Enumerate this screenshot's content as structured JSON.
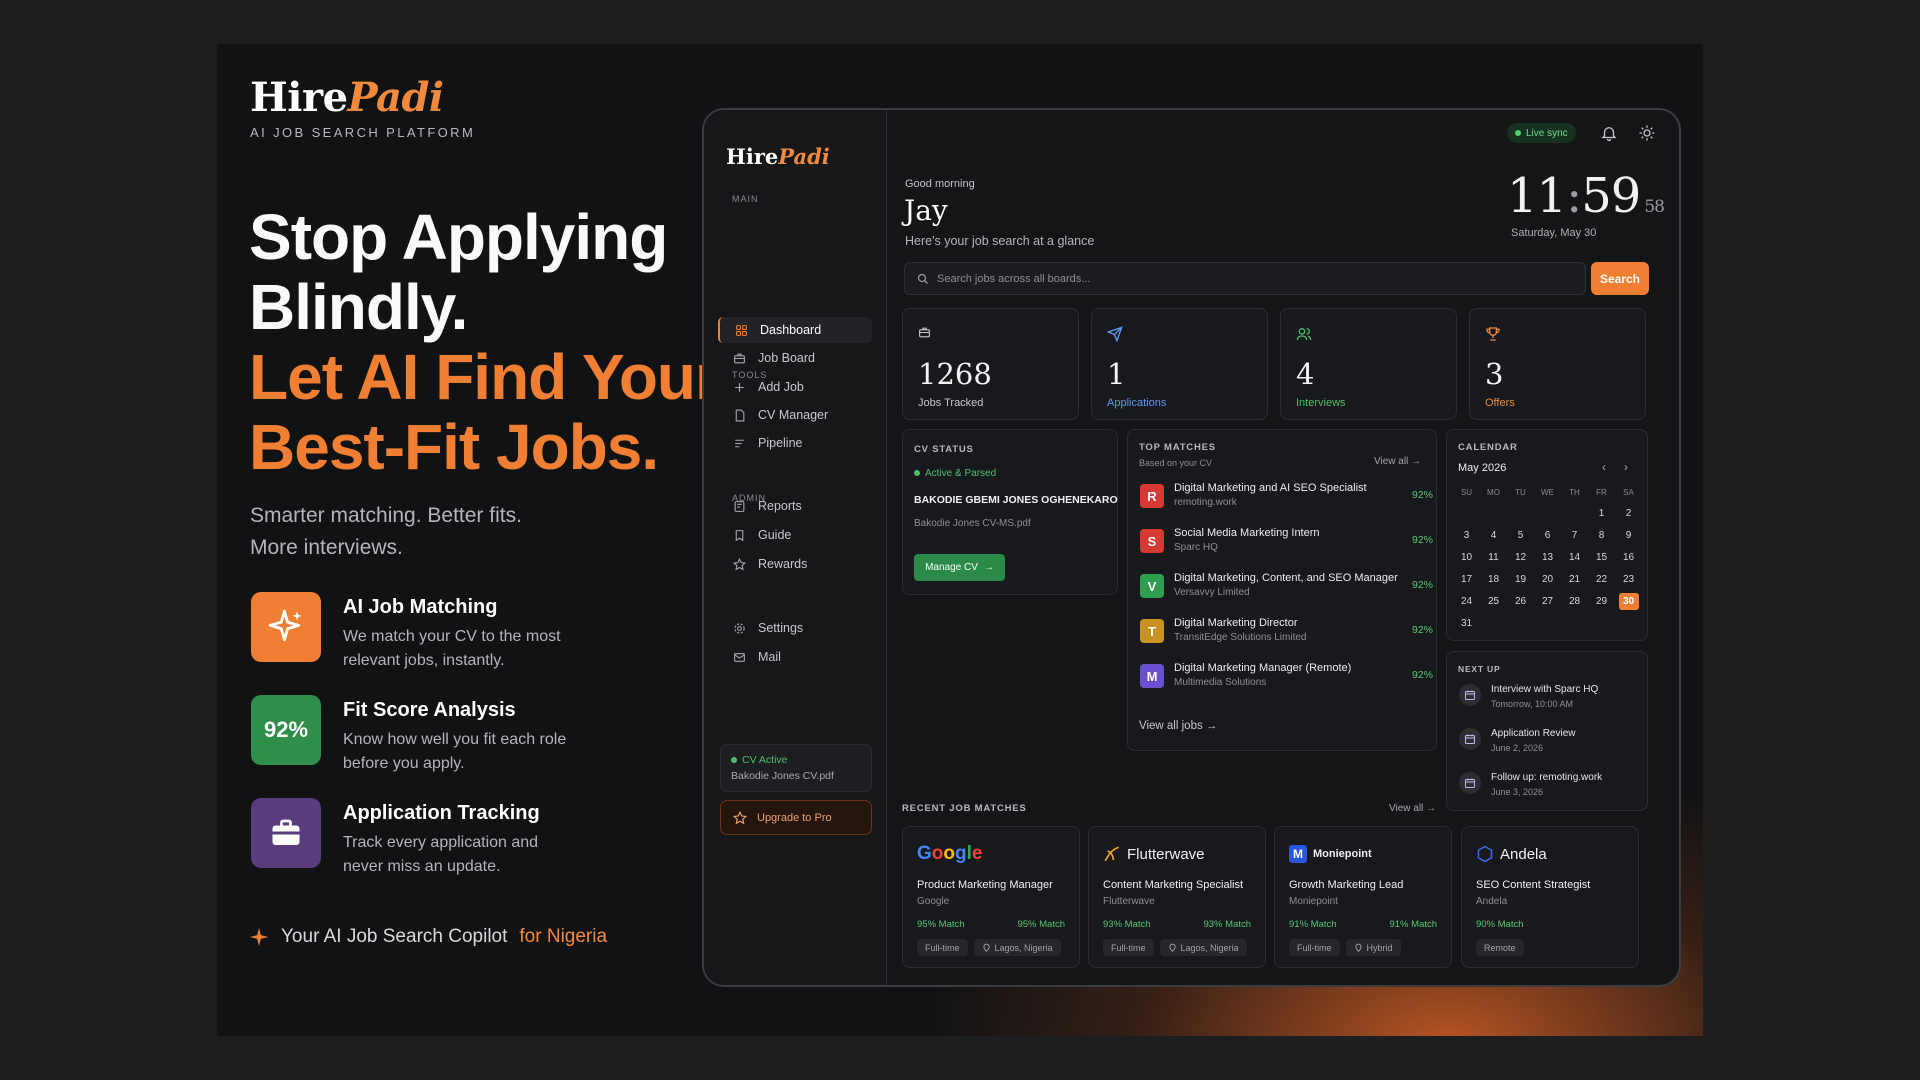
{
  "brand": {
    "name_part1": "Hire",
    "name_part2": "Padi",
    "tagline": "AI JOB SEARCH PLATFORM"
  },
  "hero": {
    "line1": "Stop Applying",
    "line2": "Blindly.",
    "line3": "Let AI Find Your",
    "line4": "Best-Fit Jobs."
  },
  "subhead": {
    "line1": "Smarter matching. Better fits.",
    "line2": "More interviews."
  },
  "features": [
    {
      "icon": "sparkle-icon",
      "badge": "",
      "title": "AI Job Matching",
      "desc_line1": "We match your CV to the most",
      "desc_line2": "relevant jobs, instantly.",
      "color": "#f07f33"
    },
    {
      "icon": "",
      "badge": "92%",
      "title": "Fit Score Analysis",
      "desc_line1": "Know how well you fit each role",
      "desc_line2": "before you apply.",
      "color": "#2f8f4a"
    },
    {
      "icon": "briefcase-icon",
      "badge": "",
      "title": "Application Tracking",
      "desc_line1": "Track every application and",
      "desc_line2": "never miss an update.",
      "color": "#5a3d7e"
    }
  ],
  "copilot": {
    "text": "Your AI Job Search Copilot",
    "accent": "for Nigeria"
  },
  "app": {
    "logo_part1": "Hire",
    "logo_part2": "Padi",
    "sections": {
      "main": "MAIN",
      "tools": "TOOLS",
      "admin": "ADMIN"
    },
    "nav": [
      {
        "label": "Dashboard",
        "icon": "grid-icon",
        "active": true
      },
      {
        "label": "Job Board",
        "icon": "briefcase-icon"
      },
      {
        "label": "Add Job",
        "icon": "plus-icon"
      },
      {
        "label": "CV Manager",
        "icon": "document-icon"
      },
      {
        "label": "Pipeline",
        "icon": "sliders-icon"
      },
      {
        "label": "Reports",
        "icon": "report-icon"
      },
      {
        "label": "Guide",
        "icon": "bookmark-icon"
      },
      {
        "label": "Rewards",
        "icon": "star-icon"
      },
      {
        "label": "Settings",
        "icon": "gear-icon"
      },
      {
        "label": "Mail",
        "icon": "mail-icon"
      }
    ],
    "cv_active": {
      "status": "CV Active",
      "file": "Bakodie Jones CV.pdf"
    },
    "upgrade": "Upgrade to Pro",
    "live_sync": "Live sync",
    "greeting": "Good morning",
    "user": "Jay",
    "glance": "Here's your job search at a glance",
    "clock": {
      "hours": "11",
      "minutes": "59",
      "seconds": "58",
      "date": "Saturday, May 30"
    },
    "search": {
      "placeholder": "Search jobs across all boards...",
      "button": "Search"
    },
    "stats": [
      {
        "value": "1268",
        "label": "Jobs Tracked",
        "color": "#c8c8cc",
        "icon": "briefcase-icon"
      },
      {
        "value": "1",
        "label": "Applications",
        "color": "#5b9cf0",
        "icon": "send-icon"
      },
      {
        "value": "4",
        "label": "Interviews",
        "color": "#48c06a",
        "icon": "users-icon"
      },
      {
        "value": "3",
        "label": "Offers",
        "color": "#f08a3c",
        "icon": "trophy-icon"
      }
    ],
    "cv_status": {
      "title": "CV STATUS",
      "state": "Active & Parsed",
      "owner": "BAKODIE GBEMI JONES OGHENEKARO",
      "file": "Bakodie Jones CV-MS.pdf",
      "button": "Manage CV"
    },
    "top_matches": {
      "title": "TOP MATCHES",
      "subtitle": "Based on your CV",
      "view_all": "View all",
      "footer": "View all jobs",
      "items": [
        {
          "letter": "R",
          "title": "Digital Marketing and AI SEO Specialist",
          "company": "remoting.work",
          "score": "92%",
          "color": "#d63a32"
        },
        {
          "letter": "S",
          "title": "Social Media Marketing Intern",
          "company": "Sparc HQ",
          "score": "92%",
          "color": "#d63a32"
        },
        {
          "letter": "V",
          "title": "Digital Marketing, Content, and SEO Manager",
          "company": "Versavvy Limited",
          "score": "92%",
          "color": "#2e9e4f"
        },
        {
          "letter": "T",
          "title": "Digital Marketing Director",
          "company": "TransitEdge Solutions Limited",
          "score": "92%",
          "color": "#c99324"
        },
        {
          "letter": "M",
          "title": "Digital Marketing Manager (Remote)",
          "company": "Multimedia Solutions",
          "score": "92%",
          "color": "#6b4fd1"
        }
      ]
    },
    "calendar": {
      "title": "CALENDAR",
      "month": "May 2026",
      "weekdays": [
        "SU",
        "MO",
        "TU",
        "WE",
        "TH",
        "FR",
        "SA"
      ],
      "first_weekday": 5,
      "days": 31,
      "today": 30
    },
    "next_up": {
      "title": "NEXT UP",
      "events": [
        {
          "title": "Interview with Sparc HQ",
          "when": "Tomorrow, 10:00 AM"
        },
        {
          "title": "Application Review",
          "when": "June 2, 2026"
        },
        {
          "title": "Follow up: remoting.work",
          "when": "June 3, 2026"
        }
      ]
    },
    "recent": {
      "title": "RECENT JOB MATCHES",
      "view_all": "View all",
      "items": [
        {
          "company": "Google",
          "role": "Product Marketing Manager",
          "match": "95% Match",
          "match2": "95% Match",
          "type": "Full-time",
          "location": "Lagos, Nigeria"
        },
        {
          "company": "Flutterwave",
          "role": "Content Marketing Specialist",
          "match": "93% Match",
          "match2": "93% Match",
          "type": "Full-time",
          "location": "Lagos, Nigeria"
        },
        {
          "company": "Moniepoint",
          "role": "Growth Marketing Lead",
          "match": "91% Match",
          "match2": "91% Match",
          "type": "Full-time",
          "location": "Hybrid"
        },
        {
          "company": "Andela",
          "role": "SEO Content Strategist",
          "match": "90% Match",
          "match2": "",
          "type": "Remote",
          "location": ""
        }
      ]
    }
  }
}
